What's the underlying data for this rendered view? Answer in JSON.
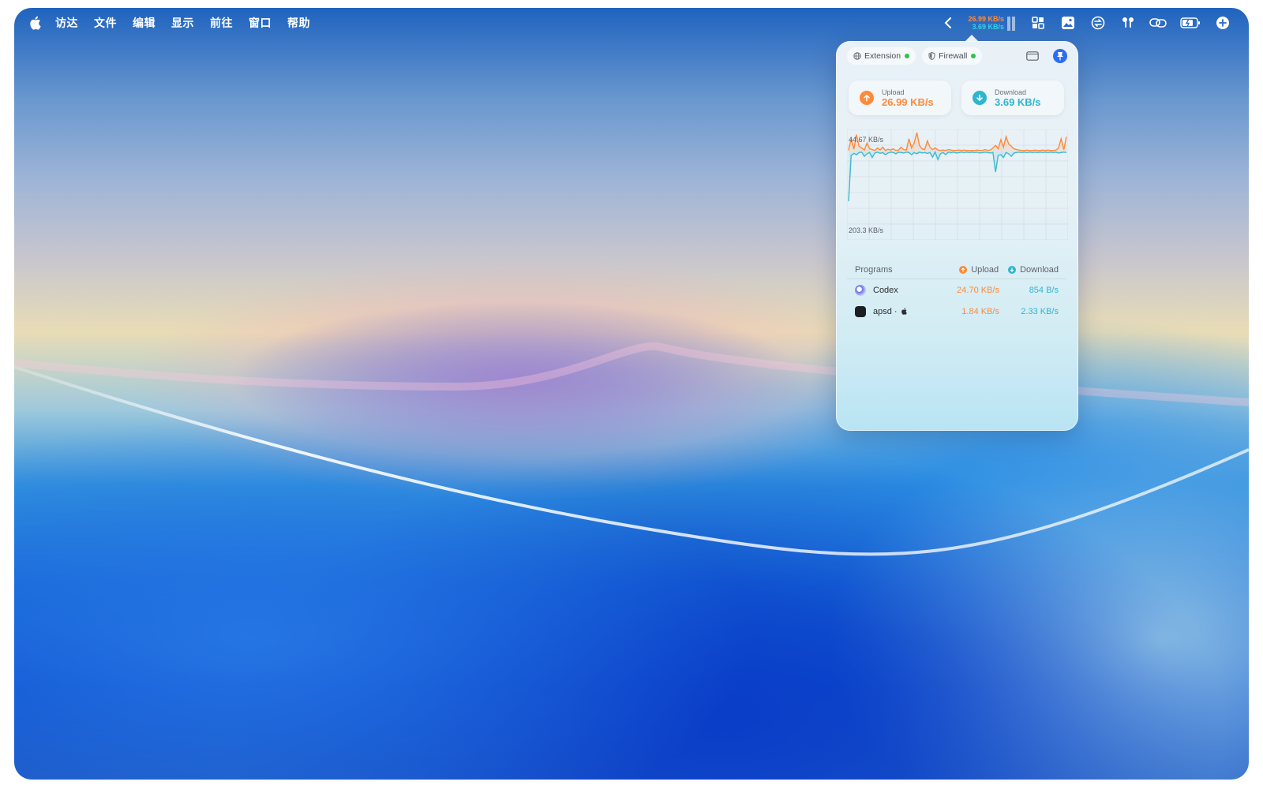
{
  "menubar": {
    "apple_icon": "apple-logo-icon",
    "items": [
      "访达",
      "文件",
      "编辑",
      "显示",
      "前往",
      "窗口",
      "帮助"
    ],
    "netspeed": {
      "upload": "26.99 KB/s",
      "download": "3.69 KB/s"
    },
    "tray_icons": [
      "chevron-left-icon",
      "network-bars-icon",
      "screenshot-icon",
      "photos-icon",
      "sync-icon",
      "airpods-icon",
      "link-icon",
      "battery-icon",
      "control-center-icon"
    ]
  },
  "panel": {
    "chips": [
      {
        "label": "Extension",
        "status_color": "#2fc24a"
      },
      {
        "label": "Firewall",
        "status_color": "#2fc24a"
      }
    ],
    "upload": {
      "label": "Upload",
      "value": "26.99 KB/s",
      "color": "#ff8a3a"
    },
    "download": {
      "label": "Download",
      "value": "3.69 KB/s",
      "color": "#2eb6cf"
    },
    "chart": {
      "top_label": "44.67 KB/s",
      "bottom_label": "203.3 KB/s"
    },
    "programs": {
      "header": {
        "programs": "Programs",
        "upload": "Upload",
        "download": "Download"
      },
      "rows": [
        {
          "name": "Codex",
          "upload": "24.70 KB/s",
          "download": "854 B/s"
        },
        {
          "name": "apsd ·",
          "upload": "1.84 KB/s",
          "download": "2.33 KB/s"
        }
      ]
    }
  },
  "chart_data": {
    "type": "line",
    "title": "",
    "series": [
      {
        "name": "Upload",
        "color": "#ff8a3a",
        "values": [
          2,
          30,
          5,
          40,
          12,
          8,
          3,
          20,
          6,
          4,
          2,
          8,
          3,
          10,
          2,
          5,
          3,
          6,
          2,
          3,
          10,
          4,
          3,
          30,
          8,
          20,
          45,
          14,
          6,
          4,
          25,
          10,
          4,
          8,
          3,
          2,
          3,
          2,
          4,
          3,
          2,
          2,
          3,
          2,
          3,
          2,
          2,
          2,
          2,
          3,
          2,
          2,
          4,
          2,
          3,
          8,
          14,
          6,
          28,
          10,
          35,
          18,
          12,
          6,
          4,
          3,
          2,
          2,
          3,
          2,
          2,
          3,
          2,
          2,
          3,
          2,
          3,
          2,
          2,
          3,
          8,
          30,
          4,
          35
        ]
      },
      {
        "name": "Download",
        "color": "#3fb8cf",
        "values": [
          -120,
          -10,
          -5,
          -8,
          -3,
          -2,
          -12,
          -6,
          -3,
          -15,
          -4,
          -2,
          -5,
          -3,
          -8,
          -4,
          -2,
          -3,
          -6,
          -2,
          -3,
          -4,
          -2,
          -3,
          -8,
          -3,
          -6,
          -2,
          -4,
          -3,
          -5,
          -3,
          -14,
          -2,
          -20,
          -6,
          -3,
          -8,
          -2,
          -3,
          -2,
          -4,
          -3,
          -2,
          -3,
          -2,
          -3,
          -2,
          -3,
          -2,
          -4,
          -3,
          -2,
          -3,
          -4,
          -3,
          -50,
          -10,
          -8,
          -15,
          -3,
          -6,
          -12,
          -4,
          -3,
          -2,
          -3,
          -2,
          -3,
          -2,
          -3,
          -2,
          -3,
          -2,
          -3,
          -2,
          -3,
          -2,
          -3,
          -2,
          -4,
          -3,
          -2,
          -3
        ]
      }
    ],
    "ylim": [
      -205,
      45
    ],
    "grid": true
  }
}
